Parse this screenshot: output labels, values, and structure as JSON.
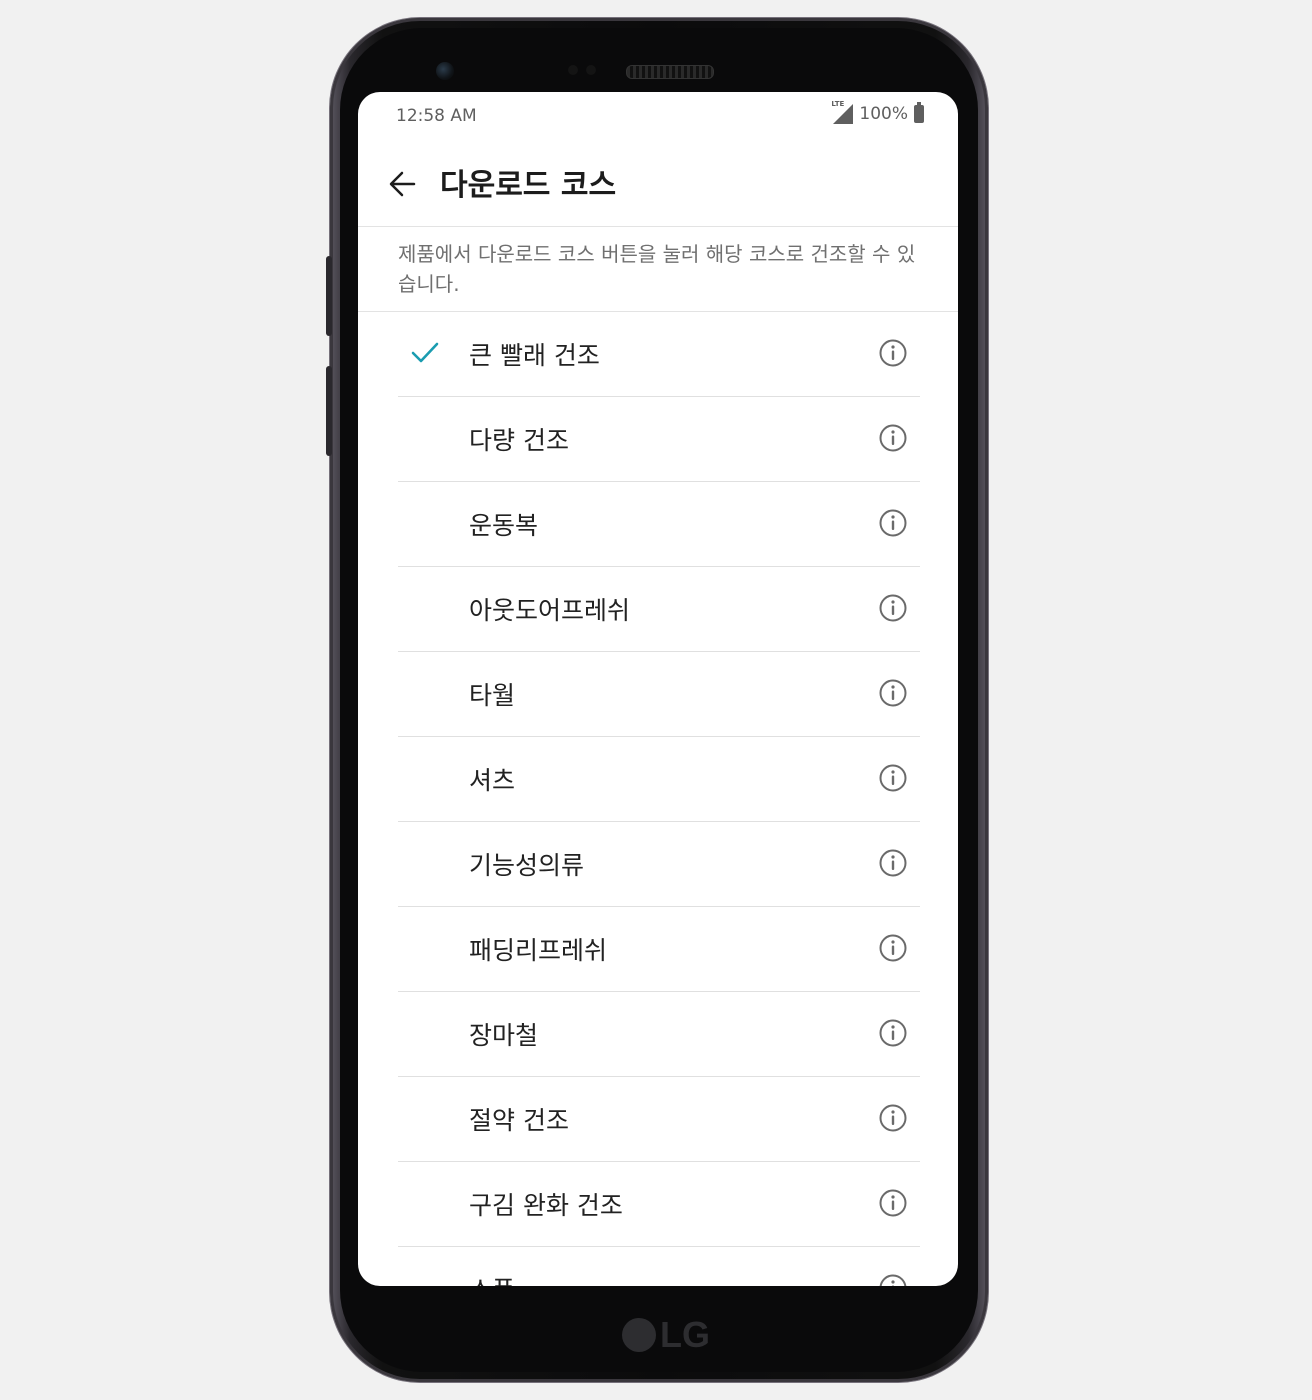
{
  "status_bar": {
    "time": "12:58 AM",
    "network": "LTE",
    "battery": "100%"
  },
  "app_bar": {
    "title": "다운로드 코스"
  },
  "description": "제품에서 다운로드 코스 버튼을 눌러 해당 코스로 건조할 수 있습니다.",
  "courses": [
    {
      "label": "큰 빨래 건조",
      "selected": true
    },
    {
      "label": "다량 건조",
      "selected": false
    },
    {
      "label": "운동복",
      "selected": false
    },
    {
      "label": "아웃도어프레쉬",
      "selected": false
    },
    {
      "label": "타월",
      "selected": false
    },
    {
      "label": "셔츠",
      "selected": false
    },
    {
      "label": "기능성의류",
      "selected": false
    },
    {
      "label": "패딩리프레쉬",
      "selected": false
    },
    {
      "label": "장마철",
      "selected": false
    },
    {
      "label": "절약 건조",
      "selected": false
    },
    {
      "label": "구김 완화 건조",
      "selected": false
    },
    {
      "label": "소품",
      "selected": false
    }
  ],
  "device": {
    "brand": "LG"
  },
  "colors": {
    "accent": "#1a9cb0",
    "screen_bg": "#ffffff",
    "page_bg": "#f1f1f1"
  }
}
